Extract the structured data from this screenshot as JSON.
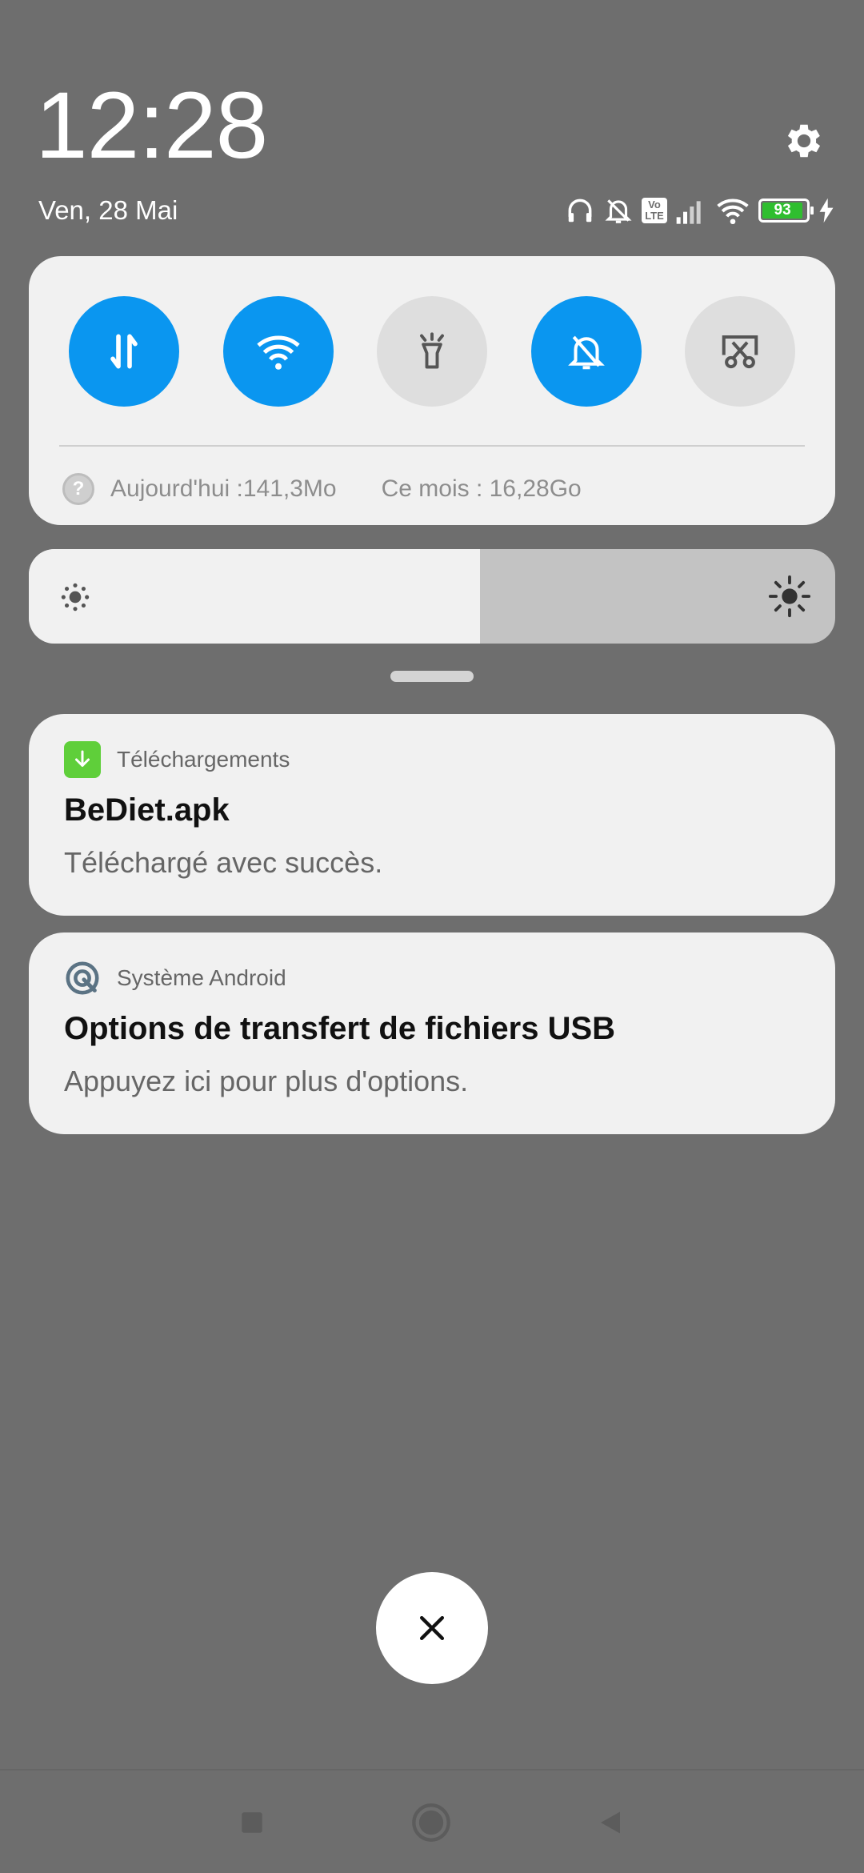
{
  "header": {
    "time": "12:28",
    "date": "Ven, 28 Mai"
  },
  "status_bar": {
    "icons": [
      "headphones-icon",
      "bell-off-icon",
      "volte-icon",
      "cell-signal-icon",
      "wifi-icon",
      "battery-icon",
      "charging-icon"
    ],
    "volte_top": "Vo",
    "volte_bottom": "LTE",
    "battery_level": "93",
    "battery_color": "#2fbe2f"
  },
  "quick_settings": {
    "toggles": [
      {
        "name": "mobile-data",
        "icon": "mobile-data-icon",
        "state": "on"
      },
      {
        "name": "wifi",
        "icon": "wifi-icon",
        "state": "on"
      },
      {
        "name": "flashlight",
        "icon": "flashlight-icon",
        "state": "off"
      },
      {
        "name": "silent",
        "icon": "bell-off-icon",
        "state": "on"
      },
      {
        "name": "screenshot",
        "icon": "screenshot-icon",
        "state": "off"
      }
    ],
    "accent_color": "#0a96f0",
    "data_today": "Aujourd'hui :141,3Mo",
    "data_month": "Ce mois : 16,28Go"
  },
  "brightness": {
    "level": 0.56
  },
  "notifications": [
    {
      "app": "Téléchargements",
      "title": "BeDiet.apk",
      "text": "Téléchargé avec succès.",
      "icon": "download-icon"
    },
    {
      "app": "Système Android",
      "title": "Options de transfert de fichiers USB",
      "text": "Appuyez ici pour plus d'options.",
      "icon": "android-system-icon"
    }
  ],
  "navigation": {
    "buttons": [
      "recents-icon",
      "home-icon",
      "back-icon"
    ]
  }
}
